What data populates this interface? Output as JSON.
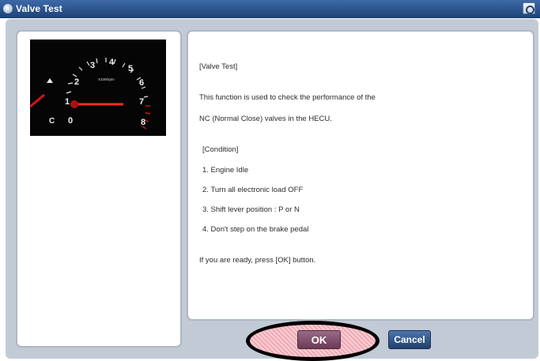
{
  "window": {
    "title": "Valve Test",
    "title_icon": "disc-icon",
    "titlebar_button_icon": "screenshot-icon"
  },
  "gauge": {
    "numbers": [
      "1",
      "2",
      "3",
      "4",
      "5",
      "6",
      "7",
      "8",
      "0"
    ],
    "unit_label": "X1000rpm",
    "left_marks": [
      "C"
    ]
  },
  "content": {
    "lines": [
      "[Valve Test]",
      "This function is used to check the performance of the",
      "NC (Normal Close) valves in the HECU.",
      "[Condition]",
      "1. Engine Idle",
      "2. Turn all electronic load OFF",
      "3. Shift lever position : P or N",
      "4. Don't step on the brake pedal",
      "If you are ready, press [OK] button."
    ]
  },
  "buttons": {
    "ok": "OK",
    "cancel": "Cancel"
  },
  "colors": {
    "titlebar": "#2c568f",
    "ok": "#7c4a66",
    "cancel": "#2c4f85",
    "highlight": "#f3b9c2"
  }
}
